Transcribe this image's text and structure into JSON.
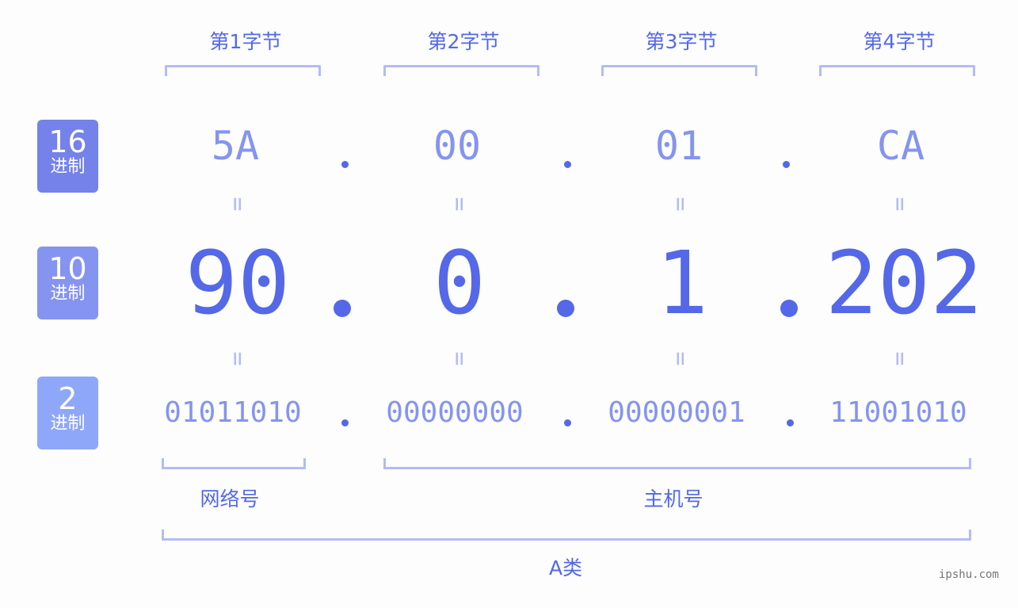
{
  "colors": {
    "primary": "#5468e8",
    "secondary": "#8494f0",
    "bracket": "#b3bcf5",
    "badge_hex": "#7482ea",
    "badge_dec": "#8594f0",
    "badge_bin": "#8fa7f8"
  },
  "bytes": [
    {
      "title": "第1字节",
      "hex": "5A",
      "dec": "90",
      "bin": "01011010"
    },
    {
      "title": "第2字节",
      "hex": "00",
      "dec": "0",
      "bin": "00000000"
    },
    {
      "title": "第3字节",
      "hex": "01",
      "dec": "1",
      "bin": "00000001"
    },
    {
      "title": "第4字节",
      "hex": "CA",
      "dec": "202",
      "bin": "11001010"
    }
  ],
  "rows": {
    "hex": {
      "num": "16",
      "label": "进制"
    },
    "dec": {
      "num": "10",
      "label": "进制"
    },
    "bin": {
      "num": "2",
      "label": "进制"
    }
  },
  "equals_sign": "=",
  "segments": {
    "network": "网络号",
    "host": "主机号",
    "class": "A类"
  },
  "watermark": "ipshu.com"
}
